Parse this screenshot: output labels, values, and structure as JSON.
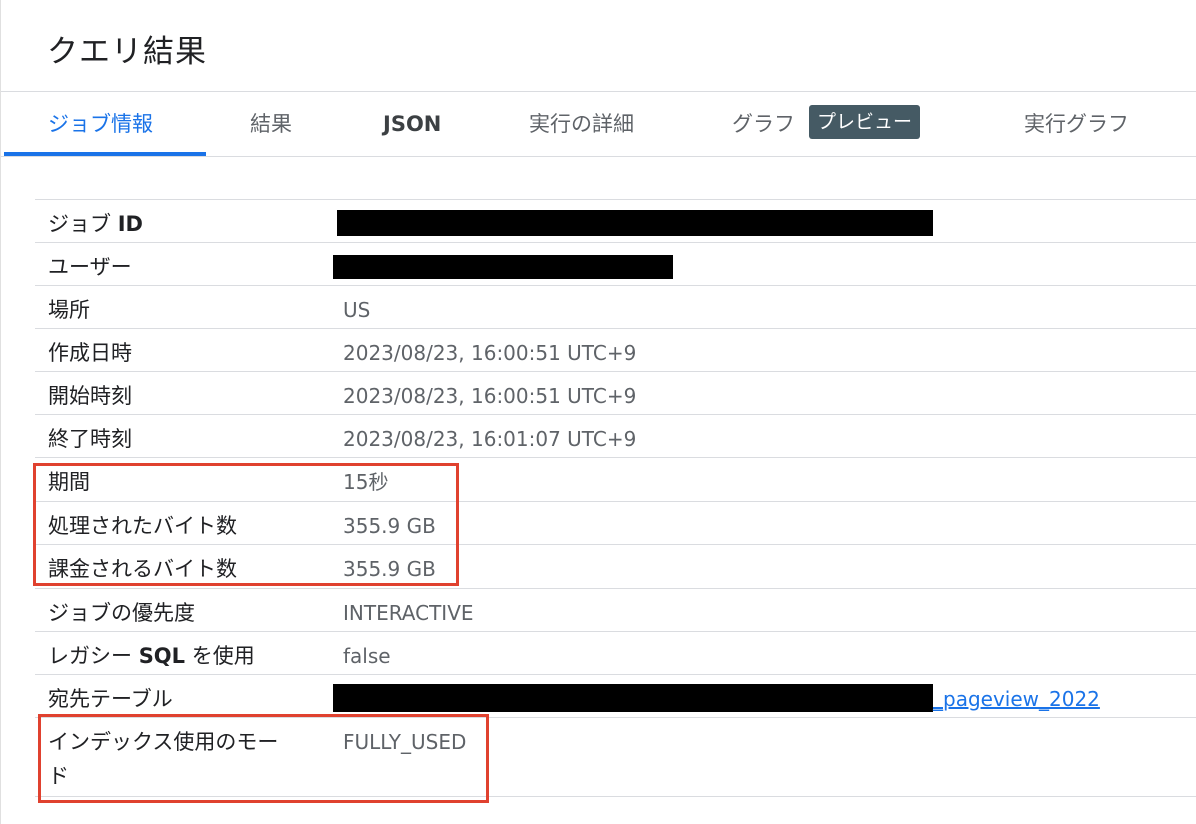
{
  "title": "クエリ結果",
  "tabs": [
    {
      "label": "ジョブ情報",
      "active": true
    },
    {
      "label": "結果"
    },
    {
      "label": "JSON"
    },
    {
      "label": "実行の詳細"
    },
    {
      "label": "グラフ",
      "badge": "プレビュー"
    },
    {
      "label": "実行グラフ"
    }
  ],
  "rows": [
    {
      "label_prefix": "ジョブ ",
      "label_bold": "ID",
      "value": "",
      "redacted": true
    },
    {
      "label": "ユーザー",
      "value": "",
      "redacted": true
    },
    {
      "label": "場所",
      "value": "US"
    },
    {
      "label": "作成日時",
      "value": "2023/08/23, 16:00:51 UTC+9"
    },
    {
      "label": "開始時刻",
      "value": "2023/08/23, 16:00:51 UTC+9"
    },
    {
      "label": "終了時刻",
      "value": "2023/08/23, 16:01:07 UTC+9"
    },
    {
      "label": "期間",
      "value": "15秒"
    },
    {
      "label": "処理されたバイト数",
      "value": "355.9 GB"
    },
    {
      "label": "課金されるバイト数",
      "value": "355.9 GB"
    },
    {
      "label": "ジョブの優先度",
      "value": "INTERACTIVE"
    },
    {
      "label_prefix": "レガシー ",
      "label_bold": "SQL",
      "label_suffix": " を使用",
      "value": "false"
    },
    {
      "label": "宛先テーブル",
      "value": "_pageview_2022",
      "link": true,
      "redacted": true
    },
    {
      "label": "インデックス使用のモード",
      "value": "FULLY_USED"
    }
  ],
  "colors": {
    "accent": "#1a73e8",
    "highlight": "#e0412f",
    "badge": "#455a64"
  }
}
